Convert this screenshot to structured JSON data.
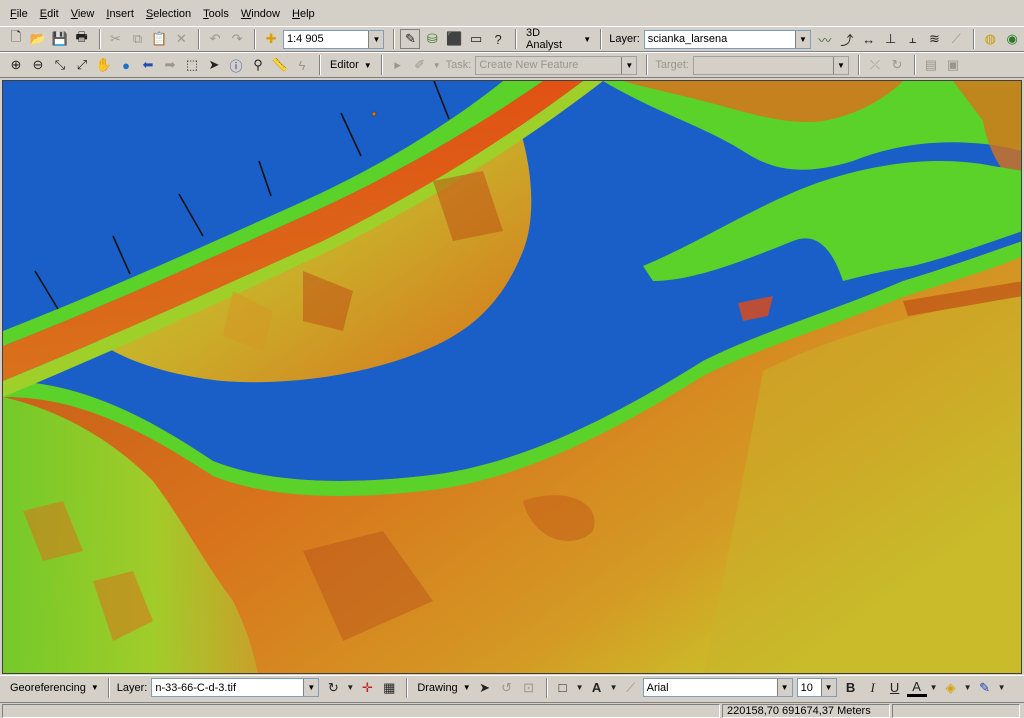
{
  "menu": [
    {
      "first": "F",
      "rest": "ile"
    },
    {
      "first": "E",
      "rest": "dit"
    },
    {
      "first": "V",
      "rest": "iew"
    },
    {
      "first": "I",
      "rest": "nsert"
    },
    {
      "first": "S",
      "rest": "election"
    },
    {
      "first": "T",
      "rest": "ools"
    },
    {
      "first": "W",
      "rest": "indow"
    },
    {
      "first": "H",
      "rest": "elp"
    }
  ],
  "standard_toolbar": {
    "scale": "1:4 905",
    "analyst_label": "3D Analyst",
    "layer_label": "Layer:",
    "layer_value": "scianka_larsena"
  },
  "editor_toolbar": {
    "editor_label": "Editor",
    "task_label": "Task:",
    "task_value": "Create New Feature",
    "target_label": "Target:",
    "target_value": ""
  },
  "bottom_toolbar": {
    "georef_label": "Georeferencing",
    "layer_label": "Layer:",
    "layer_value": "n-33-66-C-d-3.tif",
    "drawing_label": "Drawing",
    "font_value": "Arial",
    "size_value": "10",
    "bold": "B",
    "italic": "I",
    "underline": "U",
    "font_color_glyph": "A"
  },
  "status": {
    "coordinates": "220158,70  691674,37 Meters"
  },
  "colors": {
    "water": "#1a5fc7",
    "low": "#5ad22a",
    "mid": "#c9c52a",
    "high": "#d8731c",
    "peak": "#e34a12"
  }
}
